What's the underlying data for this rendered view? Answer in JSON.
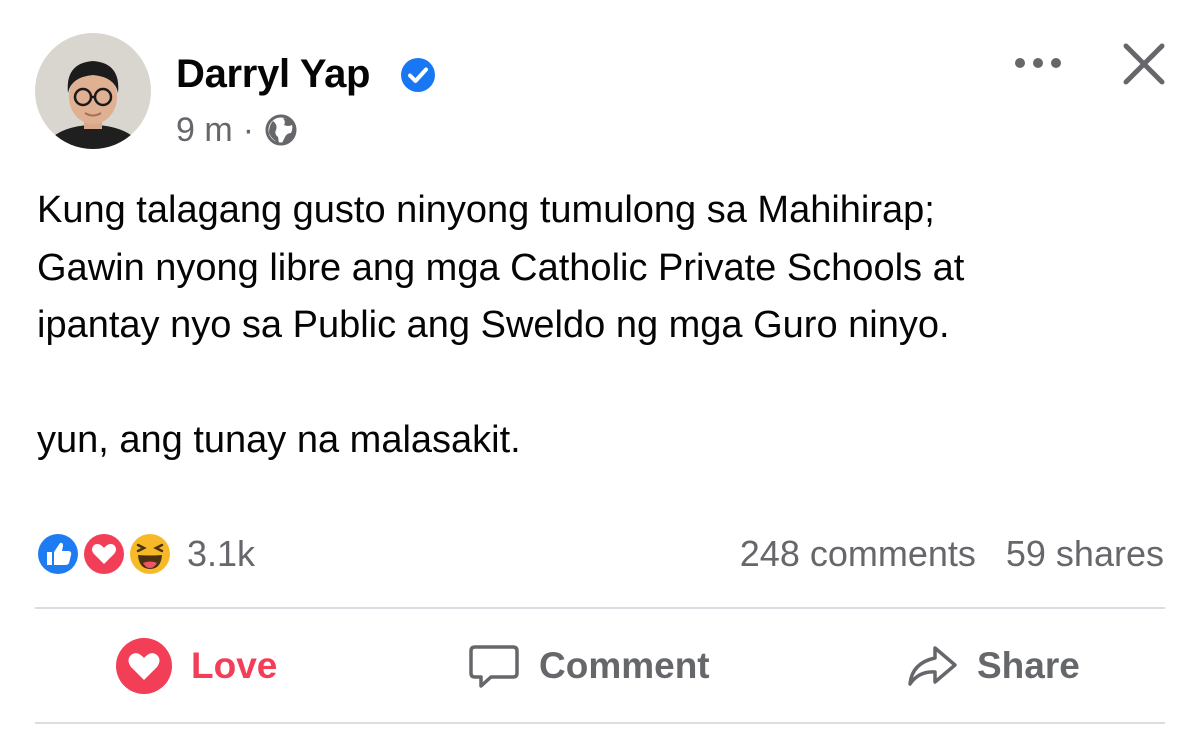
{
  "post": {
    "author": "Darryl Yap",
    "verified": true,
    "time": "9 m",
    "separator": "·",
    "audience_icon": "globe-icon",
    "text_lines": [
      "Kung talagang gusto ninyong tumulong sa Mahihirap;",
      "Gawin nyong libre ang mga Catholic Private Schools at",
      "ipantay nyo sa Public ang Sweldo ng mga Guro ninyo.",
      "",
      "yun, ang tunay na malasakit."
    ]
  },
  "header_icons": [
    "more-horizontal-icon",
    "close-icon"
  ],
  "stats": {
    "reaction_icons": [
      "like-reaction-icon",
      "love-reaction-icon",
      "haha-reaction-icon"
    ],
    "reaction_count": "3.1k",
    "comments": "248 comments",
    "shares": "59 shares"
  },
  "actions": {
    "love_label": "Love",
    "comment_label": "Comment",
    "share_label": "Share"
  },
  "colors": {
    "verified_blue": "#1877f2",
    "love_red": "#f33e58",
    "muted_text": "#65676b",
    "divider": "#dadde1"
  }
}
